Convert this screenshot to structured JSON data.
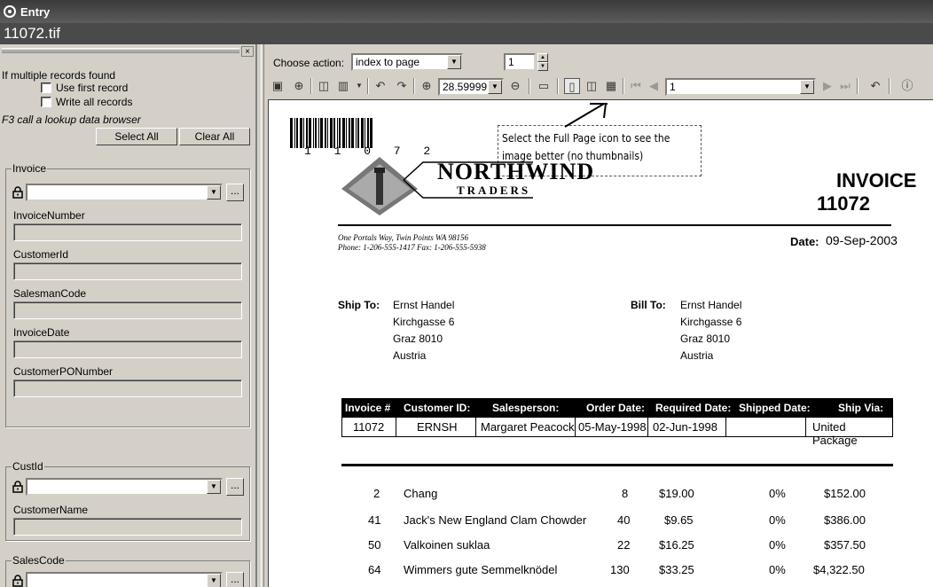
{
  "window": {
    "title": "Entry",
    "filename": "11072.tif"
  },
  "left": {
    "multi_records_label": "If multiple records found",
    "use_first": "Use first record",
    "write_all": "Write all records",
    "f3_note": "F3 call a lookup data browser",
    "select_all": "Select All",
    "clear_all": "Clear All",
    "invoice_group": "Invoice",
    "fields": [
      "InvoiceNumber",
      "CustomerId",
      "SalesmanCode",
      "InvoiceDate",
      "CustomerPONumber"
    ],
    "custid_group": "CustId",
    "customer_name": "CustomerName",
    "salescode_group": "SalesCode"
  },
  "toolbar": {
    "choose_action_label": "Choose action:",
    "action_value": "index to page",
    "page_number": "1",
    "zoom_value": "28.59999",
    "nav_page": "1"
  },
  "document": {
    "barcode_number": "1 1 0 7 2",
    "note": "Select the Full Page icon to see the image better (no thumbnails)",
    "company": "NORTHWIND",
    "company_sub": "TRADERS",
    "invoice_label": "INVOICE",
    "invoice_number": "11072",
    "address_line1": "One Portals Way, Twin Points WA 98156",
    "address_line2": "Phone: 1-206-555-1417   Fax: 1-206-555-5938",
    "date_label": "Date:",
    "date_value": "09-Sep-2003",
    "ship_to_label": "Ship To:",
    "bill_to_label": "Bill To:",
    "ship_to": [
      "Ernst Handel",
      "Kirchgasse 6",
      "Graz  8010",
      "Austria"
    ],
    "bill_to": [
      "Ernst Handel",
      "Kirchgasse 6",
      "Graz  8010",
      "Austria"
    ],
    "header_cols": [
      "Invoice #",
      "Customer ID:",
      "Salesperson:",
      "Order Date:",
      "Required Date:",
      "Shipped Date:",
      "Ship Via:"
    ],
    "header_vals": [
      "11072",
      "ERNSH",
      "Margaret Peacock",
      "05-May-1998",
      "02-Jun-1998",
      "",
      "United Package"
    ],
    "line_items": [
      {
        "id": "2",
        "name": "Chang",
        "qty": "8",
        "price": "$19.00",
        "disc": "0%",
        "total": "$152.00"
      },
      {
        "id": "41",
        "name": "Jack's New England Clam Chowder",
        "qty": "40",
        "price": "$9.65",
        "disc": "0%",
        "total": "$386.00"
      },
      {
        "id": "50",
        "name": "Valkoinen suklaa",
        "qty": "22",
        "price": "$16.25",
        "disc": "0%",
        "total": "$357.50"
      },
      {
        "id": "64",
        "name": "Wimmers gute Semmelknödel",
        "qty": "130",
        "price": "$33.25",
        "disc": "0%",
        "total": "$4,322.50"
      }
    ]
  }
}
